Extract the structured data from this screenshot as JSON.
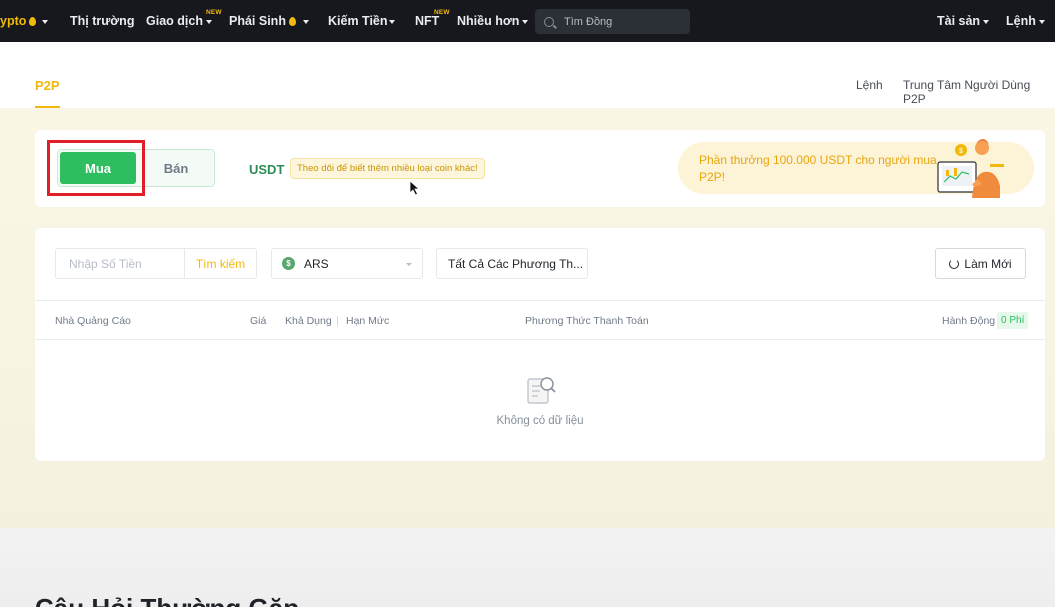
{
  "topnav": {
    "brand": "ypto",
    "market": "Thị trường",
    "trade": "Giao dịch",
    "trade_badge": "NEW",
    "derivatives": "Phái Sinh",
    "earn": "Kiếm Tiền",
    "nft": "NFT",
    "nft_badge": "NEW",
    "more": "Nhiều hơn",
    "search_placeholder": "Tìm Đồng",
    "assets": "Tài sản",
    "orders": "Lệnh",
    "accent_color": "#f0b90b"
  },
  "subheader": {
    "tab": "P2P",
    "orders_link": "Lệnh",
    "user_center_link": "Trung Tâm Người Dùng P2P"
  },
  "trade_panel": {
    "buy_label": "Mua",
    "sell_label": "Bán",
    "selected": "Mua",
    "coin": "USDT",
    "coin_hint": "Theo dõi để biết thêm nhiều loại coin khác!",
    "reward_text": "Phần thưởng 100.000 USDT cho người mua P2P!",
    "buy_color": "#2ebd5f"
  },
  "filters": {
    "amount_placeholder": "Nhập Số Tiền",
    "search_label": "Tìm kiếm",
    "fiat": "ARS",
    "fiat_symbol": "$",
    "payment_method": "Tất Cả Các Phương Th...",
    "refresh_label": "Làm Mới"
  },
  "table": {
    "headers": {
      "advertiser": "Nhà Quảng Cáo",
      "price": "Giá",
      "available": "Khả Dụng",
      "limit": "Hạn Mức",
      "payment": "Phương Thức Thanh Toán",
      "action": "Hành Động",
      "fee": "0 Phí"
    },
    "empty_text": "Không có dữ liệu"
  },
  "faq": {
    "title": "Câu Hỏi Thường Gặp"
  }
}
